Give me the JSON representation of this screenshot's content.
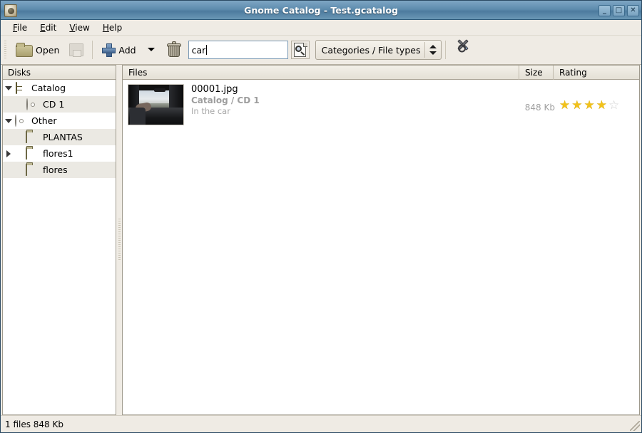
{
  "window": {
    "title": "Gnome Catalog - Test.gcatalog",
    "app_icon": "app-icon",
    "buttons": {
      "minimize": "_",
      "maximize": "□",
      "close": "✕"
    }
  },
  "menubar": {
    "items": [
      {
        "label": "File",
        "accel": "F"
      },
      {
        "label": "Edit",
        "accel": "E"
      },
      {
        "label": "View",
        "accel": "V"
      },
      {
        "label": "Help",
        "accel": "H"
      }
    ]
  },
  "toolbar": {
    "open_label": "Open",
    "save_label": "",
    "add_label": "Add",
    "delete_label": "",
    "search": {
      "value": "car",
      "placeholder": ""
    },
    "category_combo": {
      "selected": "Categories / File types",
      "options": [
        "Categories / File types"
      ]
    }
  },
  "sidebar": {
    "header": "Disks",
    "items": [
      {
        "label": "Catalog",
        "icon": "cabinet-icon",
        "expander": "down",
        "indent": 0
      },
      {
        "label": "CD 1",
        "icon": "cd-icon",
        "expander": "none",
        "indent": 1
      },
      {
        "label": "Other",
        "icon": "cd-icon",
        "expander": "down",
        "indent": 0
      },
      {
        "label": "PLANTAS",
        "icon": "folder-icon",
        "expander": "none",
        "indent": 1
      },
      {
        "label": "flores1",
        "icon": "folder-icon",
        "expander": "right",
        "indent": 1
      },
      {
        "label": "flores",
        "icon": "folder-icon",
        "expander": "none",
        "indent": 1
      }
    ]
  },
  "files": {
    "columns": {
      "files": "Files",
      "size": "Size",
      "rating": "Rating"
    },
    "rows": [
      {
        "name": "00001.jpg",
        "path": "Catalog / CD 1",
        "description": "In the car",
        "size": "848 Kb",
        "rating": 4,
        "rating_max": 5,
        "thumbnail": "car-interior-thumbnail"
      }
    ]
  },
  "statusbar": {
    "text": "1 files 848 Kb"
  },
  "colors": {
    "titlebar": "#5d8bad",
    "chrome": "#efebe4",
    "star_filled": "#f2c21a",
    "star_empty": "#cfcfcf",
    "selection_stripe": "#ebe9e3"
  }
}
